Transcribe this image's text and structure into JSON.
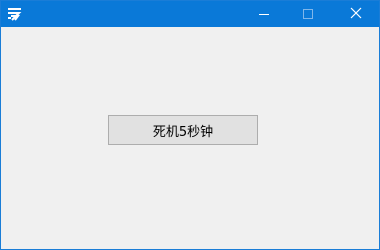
{
  "window": {
    "title": "",
    "title_bar_color": "#0a79d8",
    "client_bg_color": "#f0f0f0"
  },
  "titlebar_icons": {
    "app": "app-logo-icon",
    "minimize": "minimize-icon",
    "maximize": "maximize-icon",
    "close": "close-icon"
  },
  "main_button": {
    "label": "死机5秒钟"
  }
}
